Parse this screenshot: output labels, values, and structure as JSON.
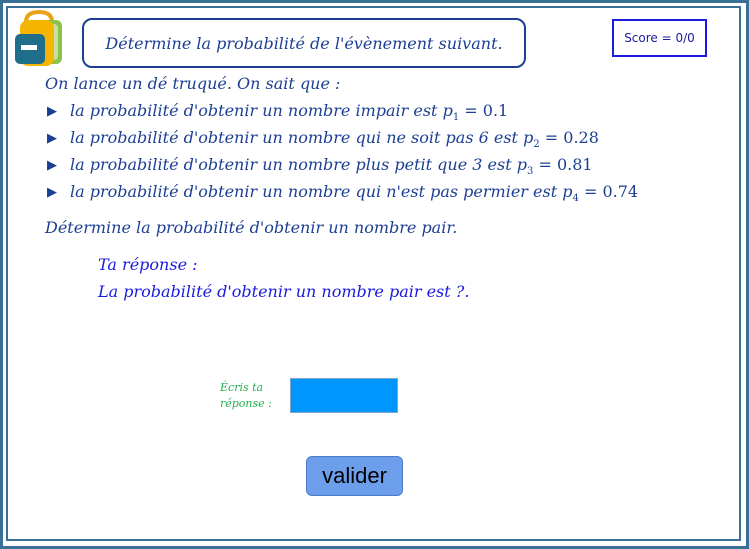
{
  "header": {
    "title": "Détermine la probabilité de l'évènement suivant.",
    "score": "Score = 0/0"
  },
  "problem": {
    "intro": "On lance un dé truqué. On sait que :",
    "conditions": [
      {
        "text": "la probabilité d'obtenir un nombre impair est",
        "var": "p",
        "sub": "1",
        "value": "= 0.1"
      },
      {
        "text": "la probabilité d'obtenir un nombre qui ne soit pas 6 est",
        "var": "p",
        "sub": "2",
        "value": "= 0.28"
      },
      {
        "text": "la probabilité d'obtenir un nombre plus petit que 3 est",
        "var": "p",
        "sub": "3",
        "value": "= 0.81"
      },
      {
        "text": "la probabilité d'obtenir un nombre qui n'est pas permier est",
        "var": "p",
        "sub": "4",
        "value": "= 0.74"
      }
    ],
    "question": "Détermine la probabilité d'obtenir un nombre pair."
  },
  "answer": {
    "heading": "Ta réponse :",
    "sentence": "La probabilité d'obtenir un nombre pair est ?."
  },
  "input": {
    "label_line1": "Écris ta",
    "label_line2": "réponse :",
    "value": ""
  },
  "buttons": {
    "validate": "valider"
  },
  "colors": {
    "frame": "#3a6f96",
    "text": "#1c3f94",
    "answer_text": "#1a1ae0",
    "label": "#22b14c",
    "input_bg": "#0096ff",
    "button_bg": "#6d9eeb"
  },
  "icons": {
    "logo": "backpack-icon",
    "bullet": "triangle-right-icon"
  }
}
